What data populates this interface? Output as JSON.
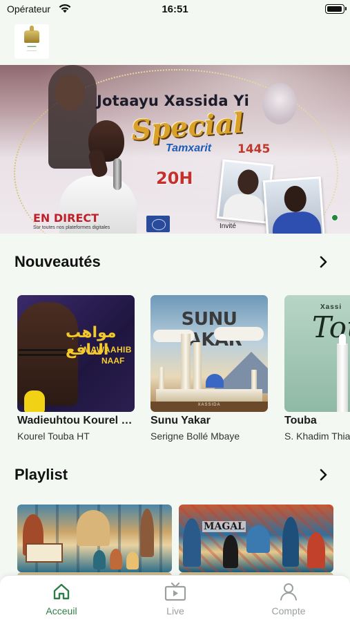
{
  "status_bar": {
    "carrier": "Opérateur",
    "time": "16:51"
  },
  "header": {
    "logo_icon": "app-logo-icon"
  },
  "banner": {
    "title": "Jotaayu Xassida Yi",
    "special": "Special",
    "subtitle": "Tamxarit",
    "year": "1445",
    "time": "20H",
    "live_label": "EN DIRECT",
    "live_sub": "Sur toutes nos plateformes digitales",
    "guest_label": "Invité"
  },
  "sections": {
    "new": {
      "title": "Nouveautés",
      "more_icon": "chevron-right-icon"
    },
    "playlist": {
      "title": "Playlist",
      "more_icon": "chevron-right-icon"
    }
  },
  "new_releases": [
    {
      "title": "Wadieuhtou Kourel Touba HT",
      "artist": "Kourel Touba HT",
      "art": {
        "arabic": "مواهب النافع",
        "line1": "MAWAAHIB",
        "line2": "NAAF"
      }
    },
    {
      "title": "Sunu Yakar",
      "artist": "Serigne Bollé Mbaye",
      "art": {
        "heading": "SUNU YAKAR",
        "footer": "XASSIDA"
      }
    },
    {
      "title": "Touba",
      "artist": "S. Khadim Thiam",
      "art": {
        "top": "Xassi",
        "heading": "Tou"
      }
    }
  ],
  "playlists": [
    {
      "art_text": ""
    },
    {
      "art_text": "MAGAL"
    }
  ],
  "tabbar": {
    "items": [
      {
        "label": "Acceuil",
        "icon": "home-icon",
        "active": true
      },
      {
        "label": "Live",
        "icon": "tv-play-icon",
        "active": false
      },
      {
        "label": "Compte",
        "icon": "user-icon",
        "active": false
      }
    ]
  },
  "colors": {
    "accent": "#2e7d46",
    "background": "#f4f8f3",
    "inactive": "#9aa09b"
  }
}
